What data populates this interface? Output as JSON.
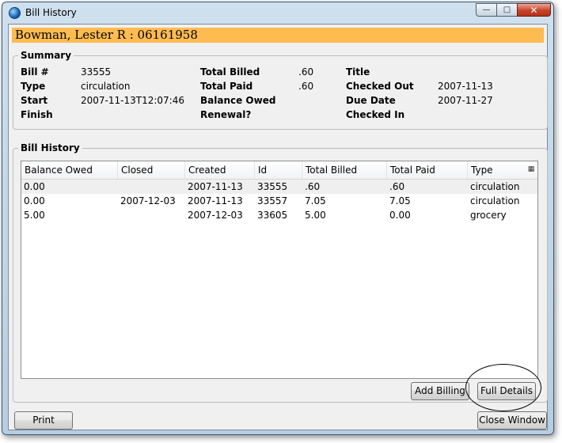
{
  "window": {
    "title": "Bill History",
    "controls": {
      "minimize": "—",
      "maximize": "□",
      "close": "✕"
    }
  },
  "patron": {
    "header": "Bowman, Lester R  : 06161958"
  },
  "summary": {
    "title": "Summary",
    "bill_num_label": "Bill #",
    "bill_num": "33555",
    "type_label": "Type",
    "type": "circulation",
    "start_label": "Start",
    "start": "2007-11-13T12:07:46",
    "finish_label": "Finish",
    "finish": "",
    "total_billed_label": "Total Billed",
    "total_billed": ".60",
    "total_paid_label": "Total Paid",
    "total_paid": ".60",
    "balance_owed_label": "Balance Owed",
    "balance_owed": "",
    "renewal_label": "Renewal?",
    "renewal": "",
    "item_title_label": "Title",
    "item_title": "",
    "checked_out_label": "Checked Out",
    "checked_out": "2007-11-13",
    "due_date_label": "Due Date",
    "due_date": "2007-11-27",
    "checked_in_label": "Checked In",
    "checked_in": ""
  },
  "history": {
    "title": "Bill History",
    "columns": [
      "Balance Owed",
      "Closed",
      "Created",
      "Id",
      "Total Billed",
      "Total Paid",
      "Type"
    ],
    "column_picker_icon": "column-picker-icon",
    "rows": [
      [
        "0.00",
        "",
        "2007-11-13",
        "33555",
        ".60",
        ".60",
        "circulation"
      ],
      [
        "0.00",
        "2007-12-03",
        "2007-11-13",
        "33557",
        "7.05",
        "7.05",
        "circulation"
      ],
      [
        "5.00",
        "",
        "2007-12-03",
        "33605",
        "5.00",
        "0.00",
        "grocery"
      ]
    ],
    "add_billing_label": "Add Billing",
    "full_details_label": "Full Details"
  },
  "footer": {
    "print_label": "Print",
    "close_label": "Close Window"
  },
  "colors": {
    "patron_bar": "#fdbb50",
    "title_bar": "#c3d6e8",
    "close_button": "#c7432a"
  }
}
